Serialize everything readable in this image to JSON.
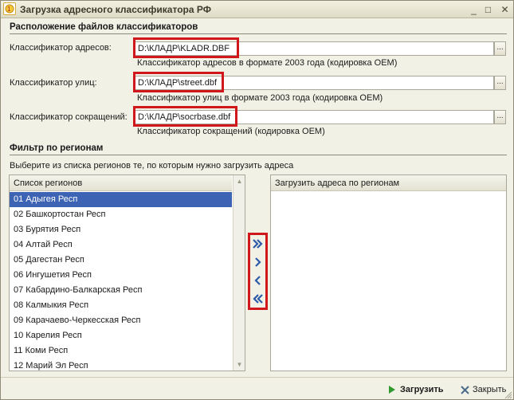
{
  "window": {
    "title": "Загрузка адресного классификатора РФ",
    "minimize_icon": "minimize-icon",
    "maximize_icon": "maximize-icon",
    "close_icon": "close-icon"
  },
  "files_section": {
    "title": "Расположение файлов классификаторов",
    "rows": [
      {
        "label": "Классификатор адресов:",
        "value": "D:\\КЛАДР\\KLADR.DBF",
        "description": "Классификатор адресов в формате 2003 года  (кодировка OEM)",
        "browse_label": "..."
      },
      {
        "label": "Классификатор улиц:",
        "value": "D:\\КЛАДР\\street.dbf",
        "description": "Классификатор улиц в формате 2003 года  (кодировка OEM)",
        "browse_label": "..."
      },
      {
        "label": "Классификатор сокращений:",
        "value": "D:\\КЛАДР\\socrbase.dbf",
        "description": "Классификатор сокращений (кодировка OEM)",
        "browse_label": "..."
      }
    ]
  },
  "filter_section": {
    "title": "Фильтр по регионам",
    "note": "Выберите из списка регионов те, по которым нужно загрузить адреса"
  },
  "regions_list": {
    "header": "Список регионов",
    "items": [
      "01 Адыгея Респ",
      "02 Башкортостан Респ",
      "03 Бурятия Респ",
      "04 Алтай Респ",
      "05 Дагестан Респ",
      "06 Ингушетия Респ",
      "07 Кабардино-Балкарская Респ",
      "08 Калмыкия Респ",
      "09 Карачаево-Черкесская Респ",
      "10 Карелия Респ",
      "11 Коми Респ",
      "12 Марий Эл Респ"
    ],
    "selected_index": 0
  },
  "target_list": {
    "header": "Загрузить адреса по регионам"
  },
  "transfer_buttons": [
    {
      "name": "add-all-button",
      "icon": "double-chevron-right-icon"
    },
    {
      "name": "add-button",
      "icon": "chevron-right-icon"
    },
    {
      "name": "remove-button",
      "icon": "chevron-left-icon"
    },
    {
      "name": "remove-all-button",
      "icon": "double-chevron-left-icon"
    }
  ],
  "footer": {
    "load_label": "Загрузить",
    "close_label": "Закрыть"
  },
  "colors": {
    "highlight": "#d0181c",
    "selection": "#3c63b4",
    "window_bg": "#f2f1e6",
    "arrow_blue": "#2d5aa8"
  }
}
